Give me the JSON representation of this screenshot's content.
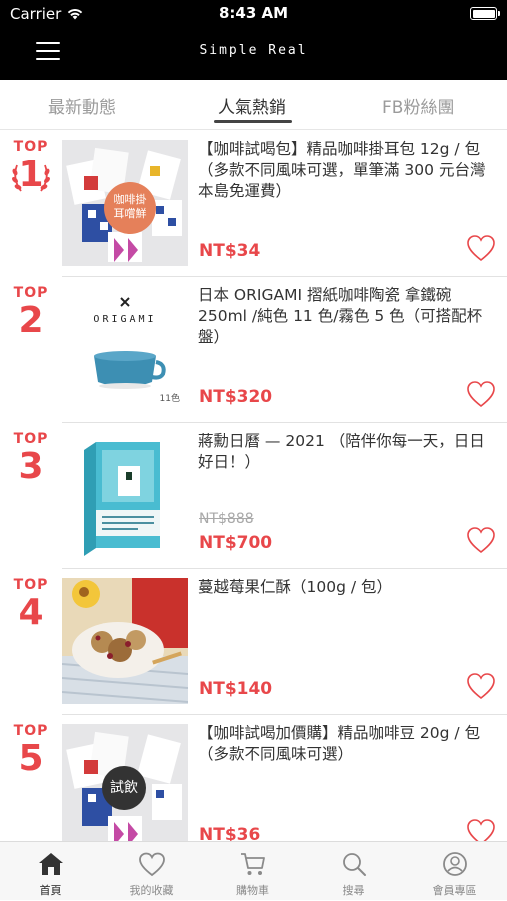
{
  "status_bar": {
    "carrier": "Carrier",
    "time": "8:43 AM"
  },
  "nav": {
    "title": "Simple Real"
  },
  "tabs": [
    {
      "label": "最新動態",
      "active": false
    },
    {
      "label": "人氣熱銷",
      "active": true
    },
    {
      "label": "FB粉絲團",
      "active": false
    }
  ],
  "accent_color": "#e8474a",
  "products": [
    {
      "rank_label": "TOP",
      "rank": "1",
      "title": "【咖啡試喝包】精品咖啡掛耳包 12g / 包（多款不同風味可選，單筆滿 300 元台灣本島免運費）",
      "old_price": "",
      "price": "NT$34",
      "badge": "咖啡掛耳嚐鮮"
    },
    {
      "rank_label": "TOP",
      "rank": "2",
      "title": "日本 ORIGAMI 摺紙咖啡陶瓷 拿鐵碗 250ml /純色 11 色/霧色 5 色（可搭配杯盤）",
      "old_price": "",
      "price": "NT$320",
      "brand": "ORIGAMI",
      "note": "11色"
    },
    {
      "rank_label": "TOP",
      "rank": "3",
      "title": "蔣勳日曆 — 2021 （陪伴你每一天，日日好日！）",
      "old_price": "NT$888",
      "price": "NT$700"
    },
    {
      "rank_label": "TOP",
      "rank": "4",
      "title": "蔓越莓果仁酥（100g / 包）",
      "old_price": "",
      "price": "NT$140"
    },
    {
      "rank_label": "TOP",
      "rank": "5",
      "title": "【咖啡試喝加價購】精品咖啡豆 20g / 包（多款不同風味可選）",
      "old_price": "",
      "price": "NT$36",
      "badge": "試飲"
    }
  ],
  "bottom_tabs": [
    {
      "label": "首頁",
      "icon": "home-icon",
      "active": true
    },
    {
      "label": "我的收藏",
      "icon": "heart-icon",
      "active": false
    },
    {
      "label": "購物車",
      "icon": "cart-icon",
      "active": false
    },
    {
      "label": "搜尋",
      "icon": "search-icon",
      "active": false
    },
    {
      "label": "會員專區",
      "icon": "user-icon",
      "active": false
    }
  ]
}
